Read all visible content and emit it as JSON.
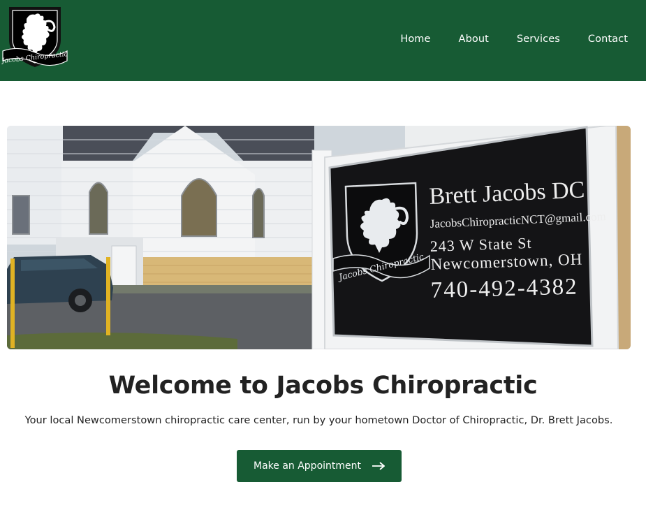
{
  "brand": {
    "primary_color": "#175b34",
    "logo_text": "Jacobs Chiropractic",
    "logo_icon": "lion-rampant-crest"
  },
  "nav": {
    "items": [
      {
        "label": "Home"
      },
      {
        "label": "About"
      },
      {
        "label": "Services"
      },
      {
        "label": "Contact"
      }
    ]
  },
  "hero": {
    "image_subject": "office-sign-photo",
    "sign": {
      "name": "Brett Jacobs DC",
      "email": "JacobsChiropracticNCT@gmail.com",
      "address_line1": "243 W State St",
      "address_line2": "Newcomerstown, OH",
      "phone": "740-492-4382",
      "crest_text": "Jacobs Chiropractic"
    }
  },
  "main": {
    "heading": "Welcome to Jacobs Chiropractic",
    "tagline": "Your local Newcomerstown chiropractic care center, run by your hometown Doctor of Chiropractic, Dr. Brett Jacobs.",
    "cta_label": "Make an Appointment",
    "cta_icon": "arrow-right-icon"
  }
}
